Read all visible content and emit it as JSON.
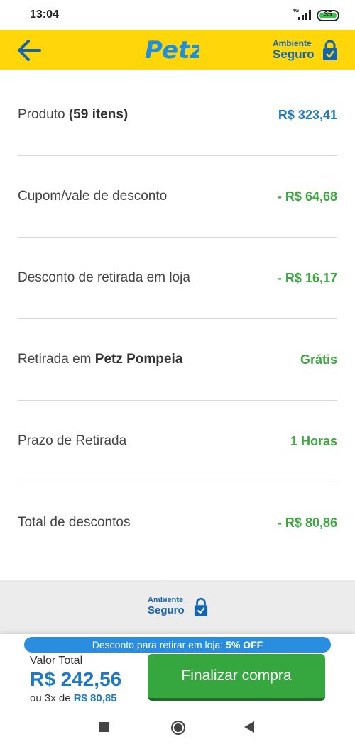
{
  "status": {
    "time": "13:04",
    "network": "4G",
    "battery": "35"
  },
  "header": {
    "logo_text": "Petz",
    "secure_line1": "Ambiente",
    "secure_line2": "Seguro"
  },
  "summary": [
    {
      "label": "Produto",
      "label_bold": "(59 itens)",
      "value": "R$ 323,41",
      "value_color": "#1f78c4"
    },
    {
      "label": "Cupom/vale de desconto",
      "label_bold": "",
      "value": "- R$ 64,68",
      "value_color": "#3ca640"
    },
    {
      "label": "Desconto de retirada em loja",
      "label_bold": "",
      "value": "- R$ 16,17",
      "value_color": "#3ca640"
    },
    {
      "label": "Retirada em",
      "label_bold": "Petz Pompeia",
      "value": "Grátis",
      "value_color": "#3ca640"
    },
    {
      "label": "Prazo de Retirada",
      "label_bold": "",
      "value": "1 Horas",
      "value_color": "#3ca640"
    },
    {
      "label": "Total de descontos",
      "label_bold": "",
      "value": "- R$ 80,86",
      "value_color": "#3ca640"
    }
  ],
  "secure_box": {
    "line1": "Ambiente",
    "line2": "Seguro"
  },
  "footer": {
    "banner_text": "Desconto para retirar em loja:",
    "banner_bold": "5% OFF",
    "total_label": "Valor Total",
    "total_value": "R$ 242,56",
    "installments_prefix": "ou 3x de",
    "installments_value": "R$ 80,85",
    "buy_button": "Finalizar compra"
  },
  "colors": {
    "header_bg": "#ffd60a",
    "brand_blue": "#1f78c4",
    "green": "#3ca640",
    "banner_blue": "#2a8ee0"
  }
}
